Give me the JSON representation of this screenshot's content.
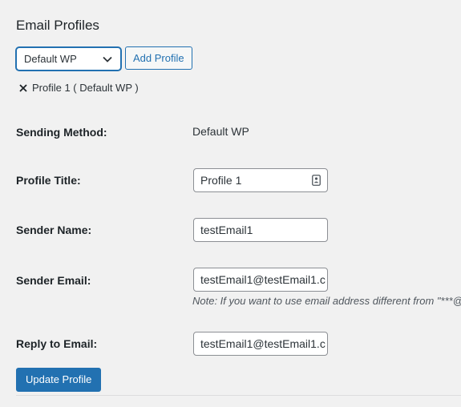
{
  "header": {
    "title": "Email Profiles"
  },
  "profile_select": {
    "selected": "Default WP",
    "add_button_label": "Add Profile"
  },
  "current_profile": {
    "tag_label": "Profile 1 ( Default WP )"
  },
  "form": {
    "sending_method": {
      "label": "Sending Method:",
      "value": "Default WP"
    },
    "profile_title": {
      "label": "Profile Title:",
      "value": "Profile 1"
    },
    "sender_name": {
      "label": "Sender Name:",
      "value": "testEmail1"
    },
    "sender_email": {
      "label": "Sender Email:",
      "value": "testEmail1@testEmail1.c",
      "note": "Note: If you want to use email address different from \"***@r"
    },
    "reply_to_email": {
      "label": "Reply to Email:",
      "value": "testEmail1@testEmail1.c"
    }
  },
  "actions": {
    "update_label": "Update Profile"
  },
  "colors": {
    "accent": "#2271b1",
    "background": "#f1f1f1",
    "text": "#1d2327"
  },
  "icons": {
    "select_chevron": "chevron-down-icon",
    "remove_profile": "close-icon",
    "profile_title_field": "contact-card-icon"
  }
}
